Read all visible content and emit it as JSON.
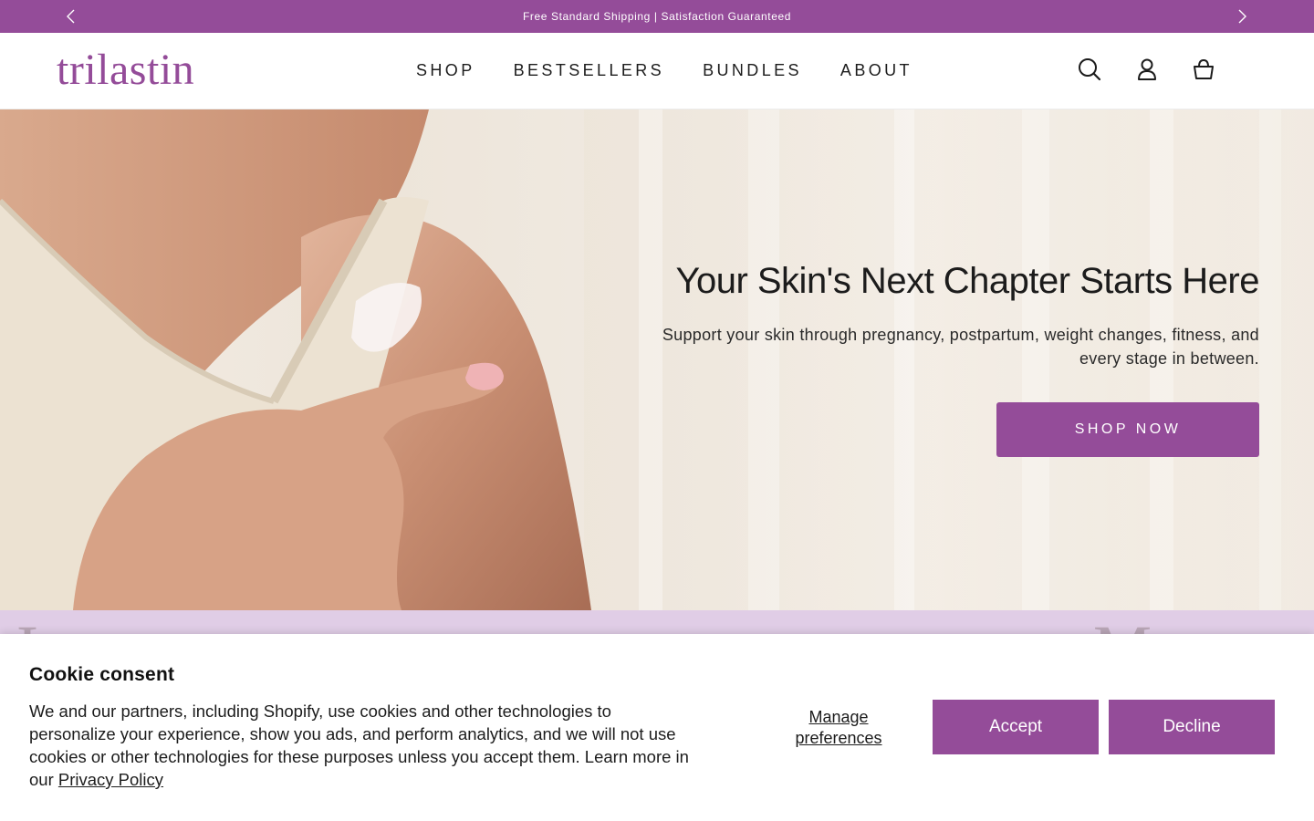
{
  "announcement": {
    "message": "Free Standard Shipping | Satisfaction Guaranteed",
    "prev_icon": "chevron-left-icon",
    "next_icon": "chevron-right-icon"
  },
  "header": {
    "logo_text": "trilastin",
    "nav": {
      "shop": "SHOP",
      "bestsellers": "BESTSELLERS",
      "bundles": "BUNDLES",
      "about": "ABOUT"
    },
    "icons": [
      "search-icon",
      "account-icon",
      "cart-icon"
    ]
  },
  "hero": {
    "title": "Your Skin's Next Chapter Starts Here",
    "subtitle": "Support your skin through pregnancy, postpartum, weight changes, fitness, and every stage in between.",
    "cta": "SHOP NOW"
  },
  "cookie": {
    "heading": "Cookie consent",
    "body": "We and our partners, including Shopify, use cookies and other technologies to personalize your experience, show you ads, and perform analytics, and we will not use cookies or other technologies for these purposes unless you accept them. Learn more in our ",
    "privacy_link": "Privacy Policy",
    "manage": "Manage preferences",
    "accept": "Accept",
    "decline": "Decline"
  },
  "colors": {
    "brand": "#944c99",
    "strip": "#e0cde6"
  }
}
